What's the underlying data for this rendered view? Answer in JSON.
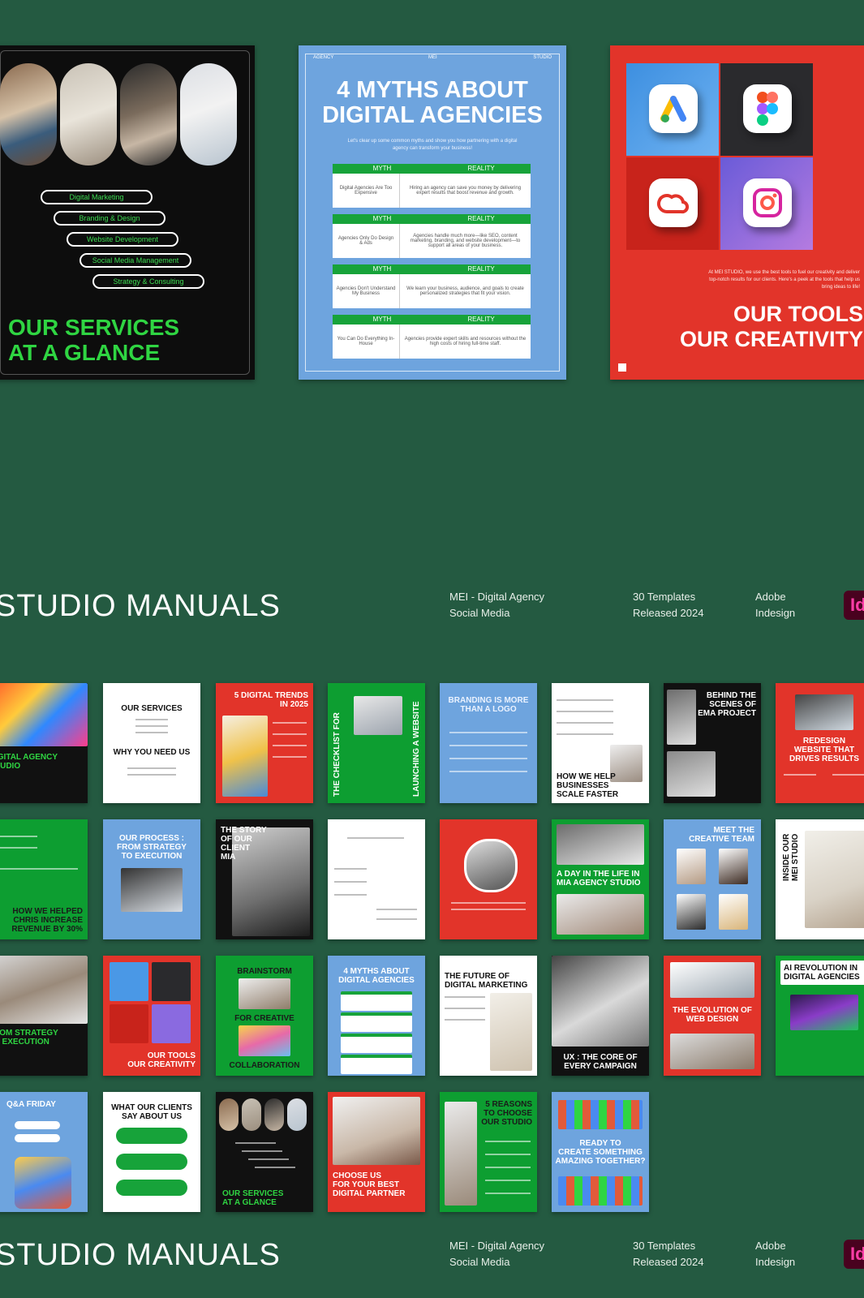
{
  "slide_services": {
    "items": [
      "Digital Marketing",
      "Branding & Design",
      "Website Development",
      "Social Media Management",
      "Strategy & Consulting"
    ],
    "title_line1": "OUR SERVICES",
    "title_line2": "AT A GLANCE"
  },
  "slide_myths": {
    "header_left": "AGENCY",
    "header_mid": "MEI",
    "header_right": "STUDIO",
    "title_line1": "4 MYTHS ABOUT",
    "title_line2": "DIGITAL AGENCIES",
    "subtitle": "Let's clear up some common myths and show you how partnering with a digital agency can transform your business!",
    "myth_label": "MYTH",
    "reality_label": "REALITY",
    "rows": [
      {
        "myth": "Digital Agencies Are Too Expensive",
        "reality": "Hiring an agency can save you money by delivering expert results that boost revenue and growth."
      },
      {
        "myth": "Agencies Only Do Design & Ads",
        "reality": "Agencies handle much more—like SEO, content marketing, branding, and website development—to support all areas of your business."
      },
      {
        "myth": "Agencies Don't Understand My Business",
        "reality": "We learn your business, audience, and goals to create personalized strategies that fit your vision."
      },
      {
        "myth": "You Can Do Everything In-House",
        "reality": "Agencies provide expert skills and resources without the high costs of hiring full-time staff."
      }
    ]
  },
  "slide_tools": {
    "caption": "At MEI STUDIO, we use the best tools to fuel our creativity and deliver top-notch results for our clients. Here's a peek at the tools that help us bring ideas to life!",
    "title_line1": "OUR TOOLS",
    "title_line2": "OUR CREATIVITY",
    "icons": [
      "google-ads-icon",
      "figma-icon",
      "creative-cloud-icon",
      "instagram-icon"
    ]
  },
  "banner": {
    "title": "STUDIO MANUALS",
    "meta1_line1": "MEI -  Digital Agency",
    "meta1_line2": "Social Media",
    "meta2_line1": "30 Templates",
    "meta2_line2": "Released 2024",
    "meta3_line1": "Adobe",
    "meta3_line2": "Indesign",
    "badge": "Id"
  },
  "thumbs": {
    "r1": [
      "IGITAL AGENCY\nTUDIO",
      "OUR SERVICES",
      "WHY YOU NEED US",
      "5 DIGITAL TRENDS\nIN 2025",
      "THE CHECKLIST FOR",
      "LAUNCHING A WEBSITE",
      "BRANDING IS MORE\nTHAN A LOGO",
      "HOW WE HELP\nBUSINESSES\nSCALE FASTER",
      "BEHIND THE\nSCENES OF\nEMA PROJECT",
      "REDESIGN\nWEBSITE THAT\nDRIVES RESULTS"
    ],
    "r2": [
      "HOW WE HELPED\nCHRIS INCREASE\nREVENUE BY 30%",
      "OUR PROCESS :\nFROM STRATEGY\nTO EXECUTION",
      "THE STORY\nOF OUR\nCLIENT\nMIA",
      "A DAY IN THE LIFE IN\nMIA AGENCY STUDIO",
      "MEET THE\nCREATIVE TEAM",
      "INSIDE OUR\nMEI STUDIO"
    ],
    "r3": [
      "ROM STRATEGY\nO EXECUTION",
      "OUR TOOLS\nOUR CREATIVITY",
      "BRAINSTORM",
      "FOR CREATIVE",
      "COLLABORATION",
      "4 MYTHS ABOUT\nDIGITAL AGENCIES",
      "THE FUTURE OF\nDIGITAL MARKETING",
      "UX : THE CORE OF\nEVERY CAMPAIGN",
      "THE EVOLUTION OF\nWEB DESIGN",
      "AI REVOLUTION IN\nDIGITAL AGENCIES"
    ],
    "r4": [
      "Q&A FRIDAY",
      "WHAT OUR CLIENTS\nSAY ABOUT US",
      "OUR SERVICES\nAT A GLANCE",
      "CHOOSE US\nFOR YOUR BEST\nDIGITAL PARTNER",
      "5 REASONS\nTO CHOOSE\nOUR STUDIO",
      "READY TO\nCREATE SOMETHING\nAMAZING TOGETHER?"
    ]
  }
}
